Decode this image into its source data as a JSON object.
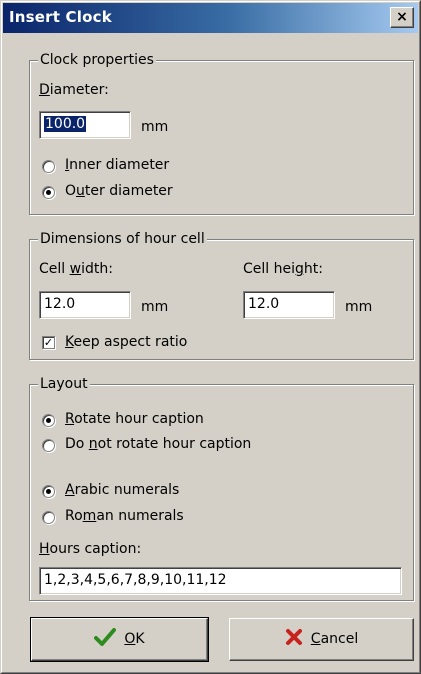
{
  "window": {
    "title": "Insert Clock",
    "close_glyph": "×"
  },
  "clock_properties": {
    "legend": "Clock properties",
    "diameter_label": {
      "accel": "D",
      "rest": "iameter:"
    },
    "diameter_value": "100.0",
    "diameter_unit": "mm",
    "inner_label": {
      "accel": "I",
      "rest": "nner diameter"
    },
    "outer_label": {
      "pre": "O",
      "accel": "u",
      "rest": "ter diameter"
    },
    "selected": "outer"
  },
  "hour_cell": {
    "legend": "Dimensions of hour cell",
    "width_label": {
      "pre": "Cell ",
      "accel": "w",
      "rest": "idth:"
    },
    "width_value": "12.0",
    "width_unit": "mm",
    "height_label": {
      "pre": "Cell hei",
      "accel": "g",
      "rest": "ht:"
    },
    "height_value": "12.0",
    "height_unit": "mm",
    "keep_aspect_label": {
      "accel": "K",
      "rest": "eep aspect ratio"
    },
    "keep_aspect_checked": true
  },
  "layout": {
    "legend": "Layout",
    "rotate_label": {
      "accel": "R",
      "rest": "otate hour caption"
    },
    "no_rotate_label": {
      "pre": "Do ",
      "accel": "n",
      "rest": "ot rotate hour caption"
    },
    "arabic_label": {
      "accel": "A",
      "rest": "rabic numerals"
    },
    "roman_label": {
      "pre": "Ro",
      "accel": "m",
      "rest": "an numerals"
    },
    "hours_caption_label": {
      "accel": "H",
      "rest": "ours caption:"
    },
    "hours_caption_value": "1,2,3,4,5,6,7,8,9,10,11,12",
    "rotation": "rotate",
    "numerals": "arabic"
  },
  "buttons": {
    "ok": {
      "accel": "O",
      "rest": "K",
      "icon": "checkmark-icon",
      "color": "#2e8b1e"
    },
    "cancel": {
      "accel": "C",
      "rest": "ancel",
      "icon": "x-mark-icon",
      "color": "#c8221e"
    }
  }
}
